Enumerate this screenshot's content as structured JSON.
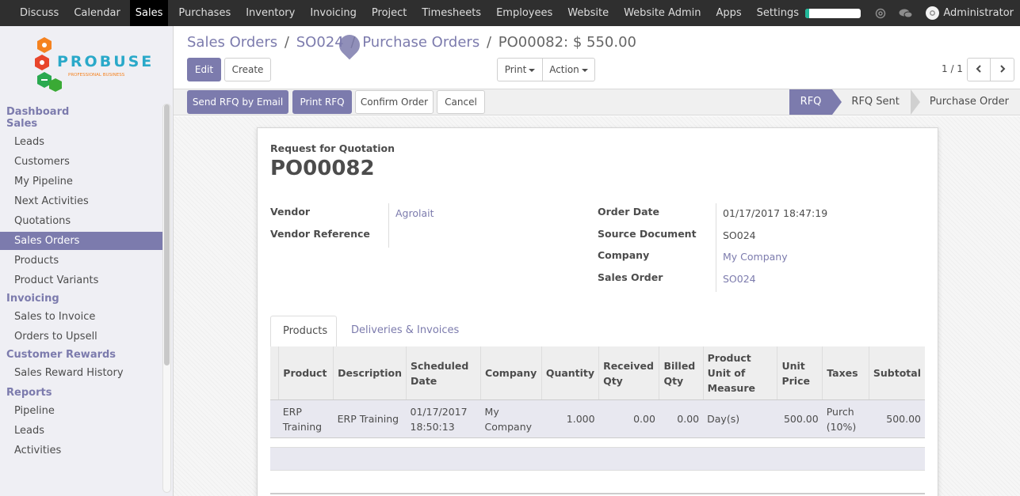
{
  "topbar": {
    "menu": [
      "Discuss",
      "Calendar",
      "Sales",
      "Purchases",
      "Inventory",
      "Invoicing",
      "Project",
      "Timesheets",
      "Employees",
      "Website",
      "Website Admin",
      "Apps",
      "Settings"
    ],
    "active_menu": "Sales",
    "progress": 0.07,
    "user_name": "Administrator",
    "accent": "#21b799"
  },
  "logo": {
    "brand": "PROBUSE",
    "tagline": "PROFESSIONAL BUSINESS"
  },
  "sidebar": {
    "sections": [
      {
        "heading": "Dashboard",
        "items": []
      },
      {
        "heading": "Sales",
        "items": [
          "Leads",
          "Customers",
          "My Pipeline",
          "Next Activities",
          "Quotations",
          "Sales Orders",
          "Products",
          "Product Variants"
        ]
      },
      {
        "heading": "Invoicing",
        "items": [
          "Sales to Invoice",
          "Orders to Upsell"
        ]
      },
      {
        "heading": "Customer Rewards",
        "items": [
          "Sales Reward History"
        ]
      },
      {
        "heading": "Reports",
        "items": [
          "Pipeline",
          "Leads",
          "Activities"
        ]
      }
    ],
    "active_item": "Sales Orders"
  },
  "breadcrumb": {
    "items": [
      "Sales Orders",
      "SO024",
      "Purchase Orders"
    ],
    "separator": "/",
    "current": "PO00082: $ 550.00"
  },
  "toolbar": {
    "edit_label": "Edit",
    "create_label": "Create",
    "print_label": "Print",
    "action_label": "Action",
    "pager": "1 / 1"
  },
  "statusbar": {
    "buttons": [
      "Send RFQ by Email",
      "Print RFQ",
      "Confirm Order",
      "Cancel"
    ],
    "stages": [
      "RFQ",
      "RFQ Sent",
      "Purchase Order"
    ],
    "active_stage": "RFQ"
  },
  "form": {
    "subtitle": "Request for Quotation",
    "title": "PO00082",
    "vendor_label": "Vendor",
    "vendor_value": "Agrolait",
    "vendor_ref_label": "Vendor Reference",
    "vendor_ref_value": "",
    "order_date_label": "Order Date",
    "order_date_value": "01/17/2017 18:47:19",
    "source_label": "Source Document",
    "source_value": "SO024",
    "company_label": "Company",
    "company_value": "My Company",
    "sales_order_label": "Sales Order",
    "sales_order_value": "SO024"
  },
  "tabs": [
    "Products",
    "Deliveries & Invoices"
  ],
  "lines": {
    "headers": [
      "Product",
      "Description",
      "Scheduled Date",
      "Company",
      "Quantity",
      "Received Qty",
      "Billed Qty",
      "Product Unit of Measure",
      "Unit Price",
      "Taxes",
      "Subtotal"
    ],
    "rows": [
      [
        "ERP Training",
        "ERP Training",
        "01/17/2017 18:50:13",
        "My Company",
        "1.000",
        "0.00",
        "0.00",
        "Day(s)",
        "500.00",
        "Purch (10%)",
        "500.00"
      ]
    ]
  },
  "colors": {
    "primary": "#7c7bad",
    "topbar": "#2f2f2f"
  }
}
